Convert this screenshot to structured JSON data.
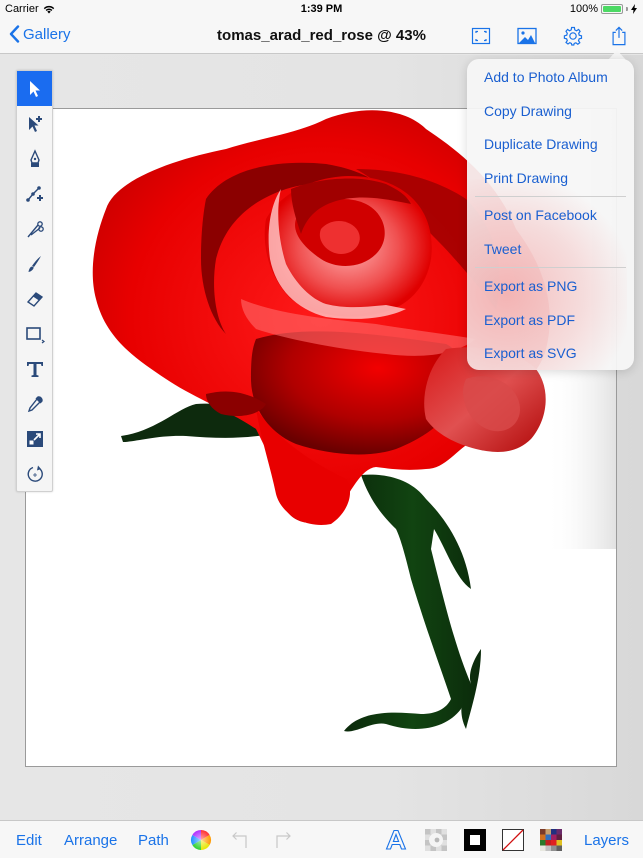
{
  "status_bar": {
    "carrier": "Carrier",
    "time": "1:39 PM",
    "battery": "100%",
    "battery_level": 1.0,
    "wifi_icon": "wifi-icon",
    "charging_icon": "bolt-icon"
  },
  "nav": {
    "back_label": "Gallery",
    "title": "tomas_arad_red_rose @ 43%",
    "zoom_percent": 43,
    "icons": [
      "fullscreen-icon",
      "image-icon",
      "gear-icon",
      "share-icon"
    ]
  },
  "toolbox": {
    "tools": [
      {
        "name": "select-tool",
        "icon": "arrow-pointer-icon",
        "active": true
      },
      {
        "name": "node-select-tool",
        "icon": "arrow-plus-icon",
        "active": false
      },
      {
        "name": "pen-tool",
        "icon": "pen-nib-icon",
        "active": false
      },
      {
        "name": "add-node-tool",
        "icon": "node-plus-icon",
        "active": false
      },
      {
        "name": "scissors-tool",
        "icon": "scissors-icon",
        "active": false
      },
      {
        "name": "brush-tool",
        "icon": "brush-icon",
        "active": false
      },
      {
        "name": "eraser-tool",
        "icon": "eraser-icon",
        "active": false
      },
      {
        "name": "shape-tool",
        "icon": "rectangle-icon",
        "active": false
      },
      {
        "name": "text-tool",
        "icon": "text-t-icon",
        "active": false
      },
      {
        "name": "eyedropper-tool",
        "icon": "eyedropper-icon",
        "active": false
      },
      {
        "name": "scale-tool",
        "icon": "scale-icon",
        "active": false
      },
      {
        "name": "rotate-tool",
        "icon": "rotate-icon",
        "active": false
      }
    ]
  },
  "share_menu": {
    "groups": [
      [
        "Add to Photo Album",
        "Copy Drawing",
        "Duplicate Drawing",
        "Print Drawing"
      ],
      [
        "Post on Facebook",
        "Tweet"
      ],
      [
        "Export as PNG",
        "Export as PDF",
        "Export as SVG"
      ]
    ]
  },
  "bottom_bar": {
    "edit": "Edit",
    "arrange": "Arrange",
    "path": "Path",
    "layers": "Layers",
    "icons": [
      "color-wheel-icon",
      "undo-icon",
      "redo-icon",
      "font-icon",
      "opacity-icon",
      "stroke-icon",
      "fill-none-icon",
      "swatches-icon"
    ]
  },
  "colors": {
    "accent": "#1a73e8",
    "active_tool": "#1a6cf0",
    "rose_red": "#e60000",
    "rose_dark": "#8b0000",
    "stem_green": "#0d2a0d"
  }
}
